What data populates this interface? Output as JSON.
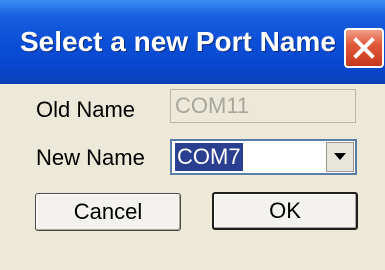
{
  "dialog": {
    "title": "Select a new Port Name",
    "close_icon": "close-icon"
  },
  "form": {
    "old_name_label": "Old Name",
    "old_name_value": "COM11",
    "new_name_label": "New Name",
    "new_name_value": "COM7",
    "dropdown_icon": "chevron-down-icon"
  },
  "buttons": {
    "cancel_label": "Cancel",
    "ok_label": "OK"
  },
  "colors": {
    "titlebar": "#0a4fd6",
    "close_button": "#e0593a",
    "dialog_background": "#ece9d8",
    "selection": "#2a3f8f"
  }
}
